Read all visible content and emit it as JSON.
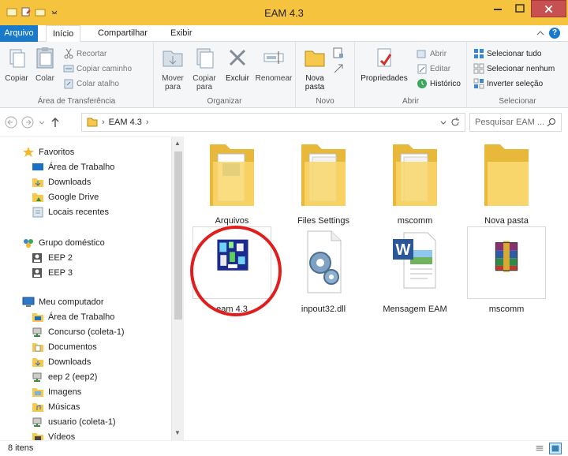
{
  "window": {
    "title": "EAM 4.3"
  },
  "ribbon": {
    "tabs": {
      "arquivo": "Arquivo",
      "inicio": "Início",
      "compartilhar": "Compartilhar",
      "exibir": "Exibir"
    },
    "help_label": "?",
    "clipboard": {
      "copiar": "Copiar",
      "colar": "Colar",
      "recortar": "Recortar",
      "copiar_caminho": "Copiar caminho",
      "colar_atalho": "Colar atalho",
      "group_label": "Área de Transferência"
    },
    "organize": {
      "mover_para": "Mover para",
      "copiar_para": "Copiar para",
      "excluir": "Excluir",
      "renomear": "Renomear",
      "group_label": "Organizar"
    },
    "new": {
      "nova_pasta": "Nova pasta",
      "group_label": "Novo"
    },
    "open": {
      "propriedades": "Propriedades",
      "abrir": "Abrir",
      "editar": "Editar",
      "historico": "Histórico",
      "group_label": "Abrir"
    },
    "select": {
      "selecionar_tudo": "Selecionar tudo",
      "selecionar_nenhum": "Selecionar nenhum",
      "inverter_selecao": "Inverter seleção",
      "group_label": "Selecionar"
    }
  },
  "address_bar": {
    "crumb": "EAM 4.3",
    "search_placeholder": "Pesquisar EAM ..."
  },
  "nav": {
    "favoritos": "Favoritos",
    "area_trabalho": "Área de Trabalho",
    "downloads": "Downloads",
    "google_drive": "Google Drive",
    "locais_recentes": "Locais recentes",
    "grupo_domestico": "Grupo doméstico",
    "eep2": "EEP 2",
    "eep3": "EEP 3",
    "meu_computador": "Meu computador",
    "area_trabalho_2": "Área de Trabalho",
    "concurso": "Concurso (coleta-1)",
    "documentos": "Documentos",
    "downloads_2": "Downloads",
    "eep2_share": "eep 2 (eep2)",
    "imagens": "Imagens",
    "musicas": "Músicas",
    "usuario": "usuario (coleta-1)",
    "videos": "Vídeos"
  },
  "files": {
    "arquivos": "Arquivos",
    "files_settings": "Files Settings",
    "mscomm_folder": "mscomm",
    "nova_pasta": "Nova pasta",
    "eam": "eam 4.3",
    "inpout": "inpout32.dll",
    "mensagem": "Mensagem EAM",
    "mscomm_rar": "mscomm"
  },
  "status": {
    "count": "8 itens"
  },
  "colors": {
    "titlebar": "#f6c33e",
    "accent": "#1979ca",
    "close": "#c75050",
    "highlight_circle": "#e01e1e"
  }
}
